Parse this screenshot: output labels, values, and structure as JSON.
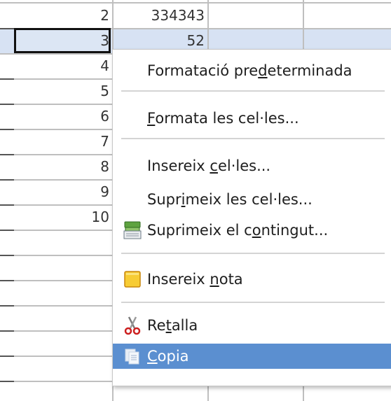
{
  "rows": [
    {
      "num": "2",
      "value": "334343"
    },
    {
      "num": "3",
      "value": "52"
    },
    {
      "num": "4",
      "value": ""
    },
    {
      "num": "5",
      "value": ""
    },
    {
      "num": "6",
      "value": ""
    },
    {
      "num": "7",
      "value": ""
    },
    {
      "num": "8",
      "value": ""
    },
    {
      "num": "9",
      "value": ""
    },
    {
      "num": "10",
      "value": ""
    }
  ],
  "context_menu": {
    "items": [
      {
        "id": "default-format",
        "pre": "Formatació pre",
        "key": "d",
        "post": "eterminada",
        "icon": ""
      },
      {
        "id": "format-cells",
        "pre": "",
        "key": "F",
        "post": "ormata les cel·les...",
        "icon": ""
      },
      {
        "id": "insert-cells",
        "pre": "Insereix ",
        "key": "c",
        "post": "el·les...",
        "icon": ""
      },
      {
        "id": "delete-cells",
        "pre": "Supr",
        "key": "i",
        "post": "meix les cel·les...",
        "icon": ""
      },
      {
        "id": "delete-contents",
        "pre": "Suprimeix el c",
        "key": "o",
        "post": "ntingut...",
        "icon": "eraser-icon"
      },
      {
        "id": "insert-note",
        "pre": "Insereix ",
        "key": "n",
        "post": "ota",
        "icon": "note-icon"
      },
      {
        "id": "cut",
        "pre": "Re",
        "key": "t",
        "post": "alla",
        "icon": "scissors-icon"
      },
      {
        "id": "copy",
        "pre": "",
        "key": "C",
        "post": "opia",
        "icon": "copy-icon"
      }
    ]
  },
  "colors": {
    "highlight": "#5b8fd0",
    "selected_row": "#d7e2f3",
    "grid": "#bfbfbf"
  }
}
